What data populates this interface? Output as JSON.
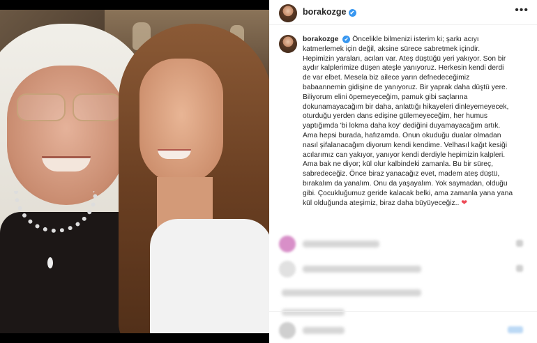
{
  "post": {
    "username": "borakozge",
    "more_label": "•••",
    "verified_glyph": "✔",
    "caption_lines": [
      "Öncelikle bilmenizi isterim ki; şarkı acıyı",
      "katmerlemek için değil, aksine sürece sabretmek içindir.",
      "Hepimizin yaraları, acıları var. Ateş düştüğü yeri yakıyor. Son bir",
      "aydır kalplerimize düşen ateşle yanıyoruz. Herkesin kendi derdi",
      "de var elbet. Mesela biz ailece yarın defnedeceğimiz",
      "babaannemin gidişine de yanıyoruz. Bir yaprak daha düştü yere.",
      "Biliyorum elini öpemeyeceğim, pamuk gibi saçlarına",
      "dokunamayacağım bir daha, anlattığı hikayeleri dinleyemeyecek,",
      "oturduğu yerden dans edişine gülemeyeceğim, her humus",
      "yaptığımda 'bi lokma daha koy' dediğini duyamayacağım artık.",
      "Ama hepsi burada, hafızamda. Onun okuduğu dualar olmadan",
      "nasıl şifalanacağım diyorum kendi kendime. Velhasıl kağıt kesiği",
      "acılarımız can yakıyor, yanıyor kendi derdiyle hepimizin kalpleri.",
      "Ama bak ne diyor; kül olur kalbindeki zamanla. Bu bir süreç,",
      "sabredeceğiz. Önce biraz yanacağız evet, madem ateş düştü,",
      "bırakalım da yanalım. Onu da yaşayalım. Yok saymadan, olduğu",
      "gibi. Çocukluğumuz geride kalacak belki, ama zamanla yana yana",
      "kül olduğunda ateşimiz, biraz daha büyüyeceğiz.."
    ],
    "heart_glyph": "❤"
  },
  "colors": {
    "verified": "#3897f0",
    "heart": "#ed4956"
  }
}
